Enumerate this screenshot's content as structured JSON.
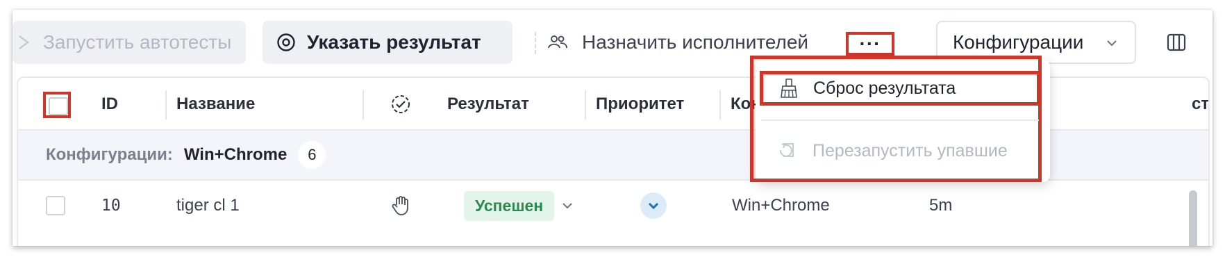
{
  "toolbar": {
    "run_autotests_label": "Запустить автотесты",
    "set_result_label": "Указать результат",
    "assign_executors_label": "Назначить исполнителей",
    "more_label": "···",
    "configurations_label": "Конфигурации"
  },
  "table": {
    "headers": {
      "id": "ID",
      "name": "Название",
      "result": "Результат",
      "priority": "Приоритет",
      "configuration": "Кон",
      "extra": "сти"
    },
    "group": {
      "label": "Конфигурации:",
      "value": "Win+Chrome",
      "count": "6"
    },
    "rows": [
      {
        "id": "10",
        "name": "tiger cl 1",
        "status": "Успешен",
        "configuration": "Win+Chrome",
        "duration": "5m"
      }
    ]
  },
  "menu": {
    "reset_result_label": "Сброс результата",
    "rerun_failed_label": "Перезапустить упавшие"
  },
  "colors": {
    "highlight": "#d0352a",
    "success_badge_bg": "#e3f5ea",
    "success_badge_text": "#2d8a4e",
    "button_bg": "#eef0f3"
  }
}
